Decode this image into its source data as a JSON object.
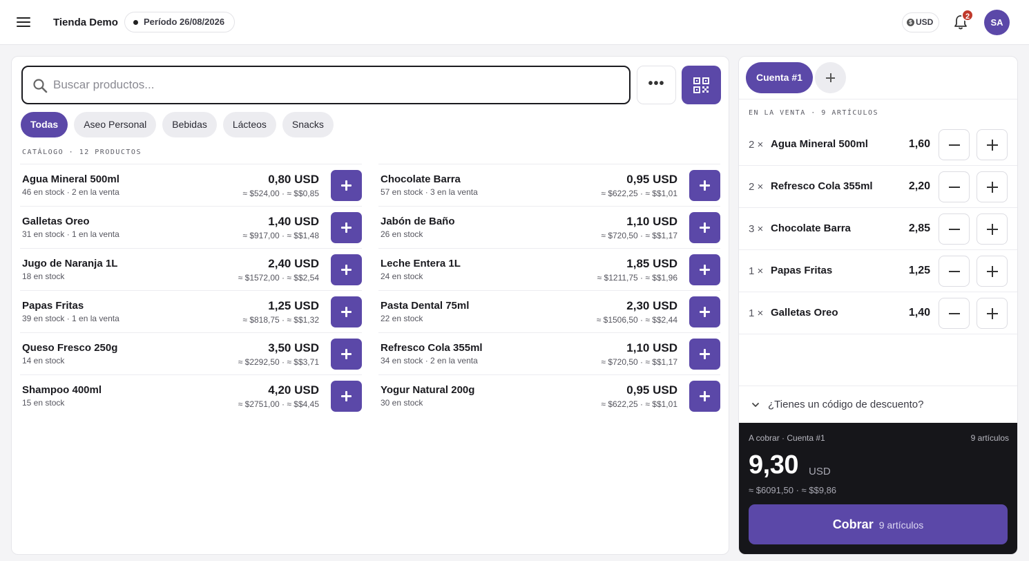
{
  "colors": {
    "accent": "#5b48a8",
    "dark_panel": "#16161a",
    "badge": "#c0392b"
  },
  "header": {
    "store_name": "Tienda Demo",
    "period_label": "Período 26/08/2026",
    "currency": "USD",
    "notifications_count": "2",
    "avatar_initials": "SA",
    "icons": [
      "menu-icon",
      "coin-icon",
      "bell-icon"
    ]
  },
  "search": {
    "placeholder": "Buscar productos...",
    "value": ""
  },
  "toolbar": {
    "more_label": "•••"
  },
  "categories": [
    {
      "label": "Todas",
      "active": true
    },
    {
      "label": "Aseo Personal",
      "active": false
    },
    {
      "label": "Bebidas",
      "active": false
    },
    {
      "label": "Lácteos",
      "active": false
    },
    {
      "label": "Snacks",
      "active": false
    }
  ],
  "catalog": {
    "label": "CATÁLOGO · 12 PRODUCTOS",
    "left_column": [
      {
        "name": "Agua Mineral 500ml",
        "stock": "46 en stock · 2 en la venta",
        "price": "0,80 USD",
        "conversions": "≈ $524,00 · ≈ $$0,85"
      },
      {
        "name": "Galletas Oreo",
        "stock": "31 en stock · 1 en la venta",
        "price": "1,40 USD",
        "conversions": "≈ $917,00 · ≈ $$1,48"
      },
      {
        "name": "Jugo de Naranja 1L",
        "stock": "18 en stock",
        "price": "2,40 USD",
        "conversions": "≈ $1572,00 · ≈ $$2,54"
      },
      {
        "name": "Papas Fritas",
        "stock": "39 en stock · 1 en la venta",
        "price": "1,25 USD",
        "conversions": "≈ $818,75 · ≈ $$1,32"
      },
      {
        "name": "Queso Fresco 250g",
        "stock": "14 en stock",
        "price": "3,50 USD",
        "conversions": "≈ $2292,50 · ≈ $$3,71"
      },
      {
        "name": "Shampoo 400ml",
        "stock": "15 en stock",
        "price": "4,20 USD",
        "conversions": "≈ $2751,00 · ≈ $$4,45"
      }
    ],
    "right_column": [
      {
        "name": "Chocolate Barra",
        "stock": "57 en stock · 3 en la venta",
        "price": "0,95 USD",
        "conversions": "≈ $622,25 · ≈ $$1,01"
      },
      {
        "name": "Jabón de Baño",
        "stock": "26 en stock",
        "price": "1,10 USD",
        "conversions": "≈ $720,50 · ≈ $$1,17"
      },
      {
        "name": "Leche Entera 1L",
        "stock": "24 en stock",
        "price": "1,85 USD",
        "conversions": "≈ $1211,75 · ≈ $$1,96"
      },
      {
        "name": "Pasta Dental 75ml",
        "stock": "22 en stock",
        "price": "2,30 USD",
        "conversions": "≈ $1506,50 · ≈ $$2,44"
      },
      {
        "name": "Refresco Cola 355ml",
        "stock": "34 en stock · 2 en la venta",
        "price": "1,10 USD",
        "conversions": "≈ $720,50 · ≈ $$1,17"
      },
      {
        "name": "Yogur Natural 200g",
        "stock": "30 en stock",
        "price": "0,95 USD",
        "conversions": "≈ $622,25 · ≈ $$1,01"
      }
    ]
  },
  "cart": {
    "active_tab": "Cuenta #1",
    "label": "EN LA VENTA · 9 ARTÍCULOS",
    "items": [
      {
        "qty": "2 ×",
        "name": "Agua Mineral 500ml",
        "amount": "1,60"
      },
      {
        "qty": "2 ×",
        "name": "Refresco Cola 355ml",
        "amount": "2,20"
      },
      {
        "qty": "3 ×",
        "name": "Chocolate Barra",
        "amount": "2,85"
      },
      {
        "qty": "1 ×",
        "name": "Papas Fritas",
        "amount": "1,25"
      },
      {
        "qty": "1 ×",
        "name": "Galletas Oreo",
        "amount": "1,40"
      }
    ],
    "discount_prompt": "¿Tienes un código de descuento?"
  },
  "checkout": {
    "label": "A cobrar · Cuenta #1",
    "item_count": "9 artículos",
    "total": "9,30",
    "currency": "USD",
    "conversions": "≈ $6091,50 · ≈ $$9,86",
    "charge_label": "Cobrar",
    "charge_sub": "9 artículos"
  }
}
